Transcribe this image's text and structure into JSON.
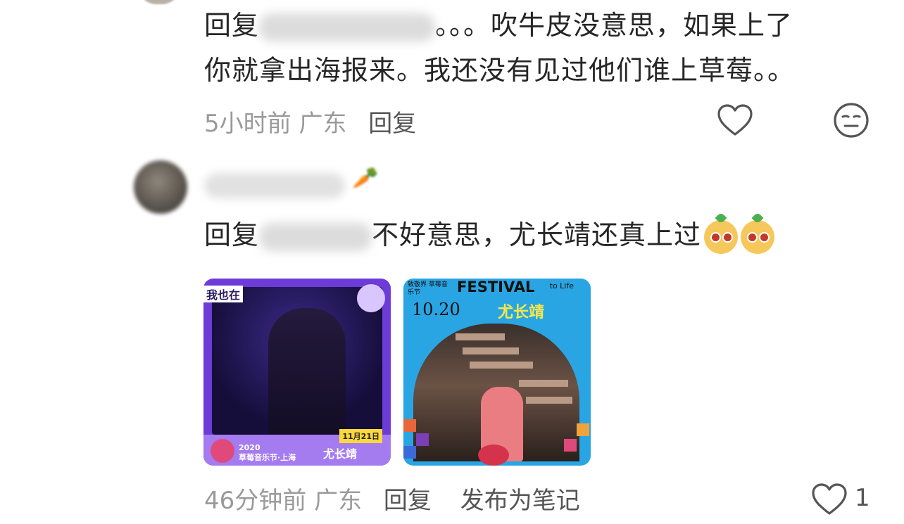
{
  "comment1": {
    "reply_prefix": "回复",
    "text_line1": "。。。吹牛皮没意思，如果上了",
    "text_line2": "你就拿出海报来。我还没有见过他们谁上草莓。。",
    "time": "5小时前",
    "location": "广东",
    "reply_label": "回复",
    "like_icon": "heart-outline-icon",
    "dislike_icon": "neutral-face-icon"
  },
  "comment2": {
    "reply_prefix": "回复",
    "text": "不好意思，尤长靖还真上过",
    "time": "46分钟前",
    "location": "广东",
    "reply_label": "回复",
    "publish_note_label": "发布为笔记",
    "like_count": "1",
    "like_icon": "heart-outline-icon"
  },
  "images": {
    "poster1": {
      "tag_text": "我也在",
      "date": "11月21日",
      "fest_line1": "2020",
      "fest_line2": "草莓音乐节·上海",
      "name": "尤长靖"
    },
    "poster2": {
      "small_text": "致敬界 草莓音乐节",
      "title": "FESTIVAL",
      "life": "to Life",
      "date": "10.20",
      "name": "尤长靖"
    }
  },
  "colors": {
    "text": "#262626",
    "meta": "#9a9a9a",
    "action": "#555555"
  }
}
